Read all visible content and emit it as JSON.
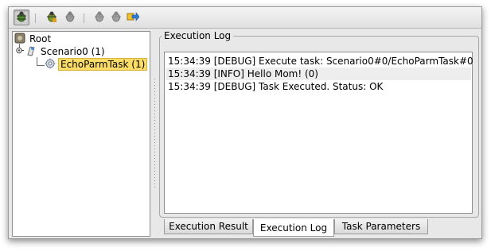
{
  "toolbar": {
    "buttons": [
      {
        "icon": "run-scenario-icon",
        "pressed": true
      },
      {
        "icon": "debug-bug-icon"
      },
      {
        "icon": "pause-bug-icon"
      },
      {
        "icon": "stop-bug-icon"
      },
      {
        "icon": "step-bug-icon"
      },
      {
        "icon": "exit-arrow-icon"
      }
    ]
  },
  "tree": {
    "root_label": "Root",
    "scenario_label": "Scenario0 (1)",
    "task_label": "EchoParmTask (1)"
  },
  "log": {
    "group_title": "Execution Log",
    "lines": [
      "15:34:39 [DEBUG] Execute task: Scenario0#0/EchoParmTask#0",
      "15:34:39 [INFO] Hello Mom! (0)",
      "15:34:39 [DEBUG] Task Executed. Status: OK"
    ]
  },
  "tabs": [
    {
      "label": "Execution Result",
      "active": false
    },
    {
      "label": "Execution Log",
      "active": true
    },
    {
      "label": "Task Parameters",
      "active": false
    }
  ],
  "colors": {
    "selection": "#fbdc66",
    "window_bg": "#e8e8e8"
  }
}
